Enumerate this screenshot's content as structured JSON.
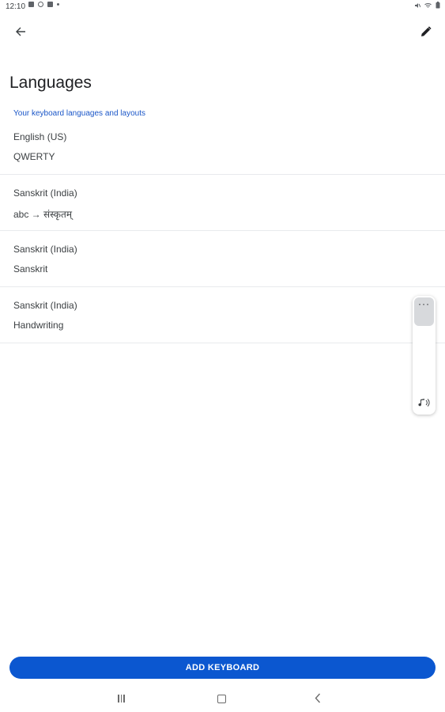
{
  "status_bar": {
    "time": "12:10",
    "left_icons": [
      "message-icon",
      "gallery-icon",
      "vpn-icon",
      "notification-dot-icon"
    ],
    "right_icons": [
      "mute-icon",
      "wifi-icon",
      "battery-icon"
    ]
  },
  "toolbar": {
    "back_icon": "arrow-left-icon",
    "edit_icon": "pencil-icon"
  },
  "page": {
    "title": "Languages",
    "section_header": "Your keyboard languages and layouts"
  },
  "languages": [
    {
      "name": "English (US)",
      "layout": "QWERTY"
    },
    {
      "name": "Sanskrit (India)",
      "layout": "abc → संस्कृतम्"
    },
    {
      "name": "Sanskrit (India)",
      "layout": "Sanskrit"
    },
    {
      "name": "Sanskrit (India)",
      "layout": "Handwriting"
    }
  ],
  "floating_panel": {
    "more_label": "···",
    "audio_icon": "audio-icon"
  },
  "add_keyboard_label": "ADD KEYBOARD",
  "colors": {
    "accent": "#0b57d0",
    "section_header": "#1a56c8",
    "text_primary": "#202124"
  }
}
